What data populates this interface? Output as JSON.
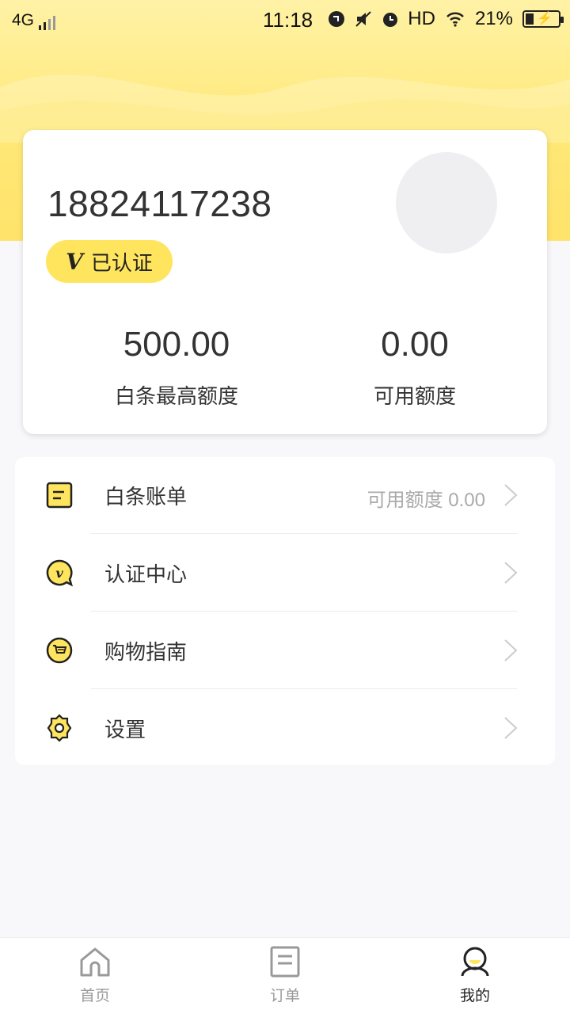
{
  "status_bar": {
    "network": "4G",
    "time": "11:18",
    "hd": "HD",
    "battery": "21%"
  },
  "profile": {
    "phone": "18824117238",
    "verified_label": "已认证",
    "verified_badge": "V",
    "max_credit_value": "500.00",
    "max_credit_label": "白条最高额度",
    "available_value": "0.00",
    "available_label": "可用额度"
  },
  "menu": {
    "items": [
      {
        "label": "白条账单",
        "extra": "可用额度 0.00",
        "icon": "bill-icon"
      },
      {
        "label": "认证中心",
        "extra": "",
        "icon": "verify-center-icon"
      },
      {
        "label": "购物指南",
        "extra": "",
        "icon": "shopping-guide-icon"
      },
      {
        "label": "设置",
        "extra": "",
        "icon": "settings-gear-icon"
      }
    ]
  },
  "tabs": [
    {
      "label": "首页",
      "icon": "home-icon",
      "active": false
    },
    {
      "label": "订单",
      "icon": "order-icon",
      "active": false
    },
    {
      "label": "我的",
      "icon": "profile-icon",
      "active": true
    }
  ],
  "colors": {
    "accent": "#ffe45e",
    "hero_top": "#fff2a6",
    "hero_bottom": "#ffe36a",
    "background": "#f8f7fa"
  }
}
